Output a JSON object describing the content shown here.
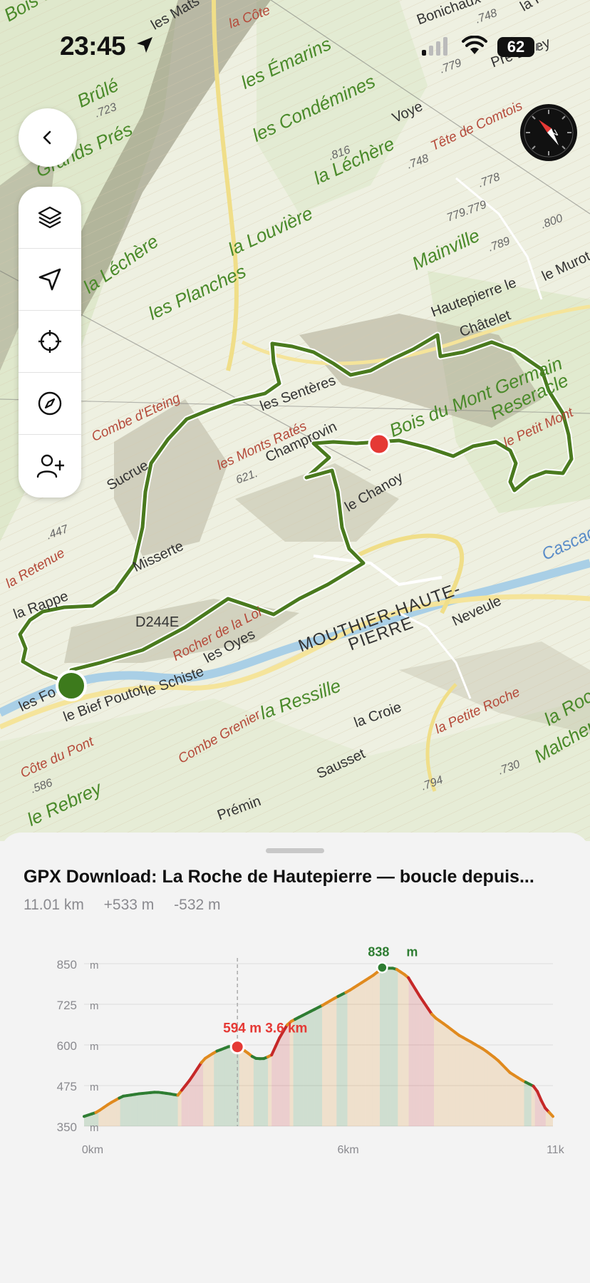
{
  "status_bar": {
    "time": "23:45",
    "battery": "62"
  },
  "map": {
    "labels": [
      {
        "text": "Bois de Houte",
        "style": "lbl-green",
        "x": 8,
        "y": 22,
        "rot": -30
      },
      {
        "text": "les Mats",
        "style": "lbl-dark",
        "x": 214,
        "y": 40,
        "rot": -30
      },
      {
        "text": "la Côte",
        "style": "lbl-red",
        "x": 322,
        "y": 38,
        "rot": -20
      },
      {
        "text": "Bonichaux",
        "style": "lbl-dark",
        "x": 586,
        "y": 32,
        "rot": -20
      },
      {
        "text": "la Pras",
        "style": "lbl-dark",
        "x": 732,
        "y": 14,
        "rot": -30
      },
      {
        "text": "Pré Lerey",
        "style": "lbl-dark",
        "x": 690,
        "y": 92,
        "rot": -20
      },
      {
        "text": "les Émarins",
        "style": "lbl-green",
        "x": 340,
        "y": 116,
        "rot": -25
      },
      {
        "text": "Brûlé",
        "style": "lbl-green",
        "x": 110,
        "y": 142,
        "rot": -25
      },
      {
        "text": "les Condémines",
        "style": "lbl-green",
        "x": 356,
        "y": 190,
        "rot": -25
      },
      {
        "text": "Voye",
        "style": "lbl-dark",
        "x": 552,
        "y": 170,
        "rot": -25
      },
      {
        "text": "Tête de Comtois",
        "style": "lbl-red",
        "x": 606,
        "y": 210,
        "rot": -25
      },
      {
        "text": "Grands Prés",
        "style": "lbl-green",
        "x": 52,
        "y": 240,
        "rot": -25
      },
      {
        "text": "la Léchère",
        "style": "lbl-green",
        "x": 442,
        "y": 250,
        "rot": -25
      },
      {
        "text": "la Léchère",
        "style": "lbl-green",
        "x": 120,
        "y": 404,
        "rot": -35
      },
      {
        "text": "les Planches",
        "style": "lbl-green",
        "x": 210,
        "y": 440,
        "rot": -25
      },
      {
        "text": "la Louvière",
        "style": "lbl-green",
        "x": 322,
        "y": 350,
        "rot": -25
      },
      {
        "text": "Mainville",
        "style": "lbl-green",
        "x": 580,
        "y": 370,
        "rot": -25
      },
      {
        "text": "le Murot",
        "style": "lbl-dark",
        "x": 762,
        "y": 392,
        "rot": -25
      },
      {
        "text": "Hautepierre le",
        "style": "lbl-dark",
        "x": 606,
        "y": 442,
        "rot": -20
      },
      {
        "text": "Châtelet",
        "style": "lbl-dark",
        "x": 646,
        "y": 470,
        "rot": -20
      },
      {
        "text": "les Sentères",
        "style": "lbl-dark",
        "x": 366,
        "y": 574,
        "rot": -20
      },
      {
        "text": "Bois du Mont Germain",
        "style": "lbl-green",
        "x": 548,
        "y": 604,
        "rot": -22
      },
      {
        "text": "Reseracle",
        "style": "lbl-green",
        "x": 690,
        "y": 580,
        "rot": -25
      },
      {
        "text": "le Petit Mont",
        "style": "lbl-red",
        "x": 708,
        "y": 626,
        "rot": -25
      },
      {
        "text": "Combe d'Eteing",
        "style": "lbl-red",
        "x": 130,
        "y": 618,
        "rot": -25
      },
      {
        "text": "les Monts Ratés",
        "style": "lbl-red",
        "x": 306,
        "y": 658,
        "rot": -25
      },
      {
        "text": "Champrovin",
        "style": "lbl-dark",
        "x": 374,
        "y": 646,
        "rot": -25
      },
      {
        "text": "Sucrue",
        "style": "lbl-dark",
        "x": 152,
        "y": 686,
        "rot": -30
      },
      {
        "text": "le Chanoy",
        "style": "lbl-dark",
        "x": 486,
        "y": 716,
        "rot": -30
      },
      {
        "text": "Cascade",
        "style": "lbl-blue",
        "x": 762,
        "y": 780,
        "rot": -25
      },
      {
        "text": "la Retenue",
        "style": "lbl-red",
        "x": 10,
        "y": 824,
        "rot": -30
      },
      {
        "text": "la Rappe",
        "style": "lbl-dark",
        "x": 20,
        "y": 866,
        "rot": -20
      },
      {
        "text": "Misserte",
        "style": "lbl-dark",
        "x": 188,
        "y": 800,
        "rot": -25
      },
      {
        "text": "D244E",
        "style": "lbl-dark",
        "x": 190,
        "y": 876,
        "rot": 0
      },
      {
        "text": "MOUTHIER-HAUTE-",
        "style": "lbl-big",
        "x": 420,
        "y": 908,
        "rot": -20
      },
      {
        "text": "PIERRE",
        "style": "lbl-big",
        "x": 490,
        "y": 906,
        "rot": -20
      },
      {
        "text": "Neveule",
        "style": "lbl-dark",
        "x": 636,
        "y": 876,
        "rot": -25
      },
      {
        "text": "Rocher de la Loi",
        "style": "lbl-red",
        "x": 244,
        "y": 926,
        "rot": -28
      },
      {
        "text": "les Oyes",
        "style": "lbl-dark",
        "x": 288,
        "y": 928,
        "rot": -28
      },
      {
        "text": "le Schiste",
        "style": "lbl-dark",
        "x": 204,
        "y": 974,
        "rot": -20
      },
      {
        "text": "les Fo",
        "style": "lbl-dark",
        "x": 28,
        "y": 996,
        "rot": -25
      },
      {
        "text": "le Bief Poutot",
        "style": "lbl-dark",
        "x": 90,
        "y": 1010,
        "rot": -20
      },
      {
        "text": "la Ressille",
        "style": "lbl-green",
        "x": 366,
        "y": 1000,
        "rot": -20
      },
      {
        "text": "la Croie",
        "style": "lbl-dark",
        "x": 498,
        "y": 1018,
        "rot": -20
      },
      {
        "text": "la Petite Roche",
        "style": "lbl-red",
        "x": 612,
        "y": 1028,
        "rot": -25
      },
      {
        "text": "la Roche",
        "style": "lbl-green",
        "x": 766,
        "y": 1010,
        "rot": -30
      },
      {
        "text": "Combe Grenier",
        "style": "lbl-red",
        "x": 252,
        "y": 1070,
        "rot": -30
      },
      {
        "text": "Côte du Pont",
        "style": "lbl-red",
        "x": 30,
        "y": 1090,
        "rot": -25
      },
      {
        "text": "Sausset",
        "style": "lbl-dark",
        "x": 446,
        "y": 1090,
        "rot": -25
      },
      {
        "text": "Malchen",
        "style": "lbl-green",
        "x": 752,
        "y": 1062,
        "rot": -30
      },
      {
        "text": "le Rebrey",
        "style": "lbl-green",
        "x": 40,
        "y": 1150,
        "rot": -25
      },
      {
        "text": "Prémin",
        "style": "lbl-dark",
        "x": 306,
        "y": 1148,
        "rot": -20
      }
    ],
    "spot_heights": [
      {
        "text": ".723",
        "x": 134,
        "y": 162
      },
      {
        "text": ".816",
        "x": 462,
        "y": 222
      },
      {
        "text": ".748",
        "x": 572,
        "y": 234
      },
      {
        "text": ".778",
        "x": 672,
        "y": 260
      },
      {
        "text": "779.779",
        "x": 628,
        "y": 308
      },
      {
        "text": ".800",
        "x": 760,
        "y": 318
      },
      {
        "text": ".789",
        "x": 686,
        "y": 350
      },
      {
        "text": ".748",
        "x": 668,
        "y": 30
      },
      {
        "text": ".779",
        "x": 618,
        "y": 100
      },
      {
        "text": ".447",
        "x": 66,
        "y": 754
      },
      {
        "text": "621.",
        "x": 332,
        "y": 676
      },
      {
        "text": ".586",
        "x": 44,
        "y": 1110
      },
      {
        "text": ".794",
        "x": 592,
        "y": 1106
      },
      {
        "text": ".730",
        "x": 700,
        "y": 1084
      }
    ]
  },
  "sheet": {
    "title": "GPX Download: La Roche de Hautepierre — boucle depuis...",
    "distance": "11.01 km",
    "ascent": "+533 m",
    "descent": "-532 m"
  },
  "chart_data": {
    "type": "area",
    "x_unit": "km",
    "y_unit": "m",
    "xlim": [
      0,
      11.01
    ],
    "ylim": [
      350,
      850
    ],
    "y_ticks": [
      "850",
      "725",
      "600",
      "475",
      "350"
    ],
    "y_tick_unit": "m",
    "x_ticks": [
      "0km",
      "6km",
      "11k"
    ],
    "x": [
      0,
      0.3,
      0.6,
      0.9,
      1.3,
      1.7,
      2.0,
      2.2,
      2.5,
      2.8,
      3.1,
      3.4,
      3.6,
      3.8,
      4.0,
      4.2,
      4.4,
      4.6,
      4.8,
      5.0,
      5.3,
      5.6,
      5.9,
      6.2,
      6.5,
      6.8,
      7.0,
      7.3,
      7.6,
      7.9,
      8.2,
      8.5,
      8.8,
      9.1,
      9.4,
      9.7,
      10.0,
      10.3,
      10.6,
      10.8,
      11.01
    ],
    "y": [
      380,
      393,
      420,
      442,
      450,
      455,
      450,
      445,
      495,
      555,
      580,
      595,
      595,
      580,
      559,
      557,
      568,
      625,
      668,
      682,
      702,
      722,
      745,
      765,
      790,
      815,
      836,
      836,
      810,
      746,
      688,
      660,
      630,
      608,
      585,
      555,
      515,
      490,
      470,
      410,
      380
    ],
    "marker": {
      "x": 3.6,
      "y": 594,
      "label": "594 m 3.6 km"
    },
    "max": {
      "x": 7.0,
      "y": 838,
      "label": "838",
      "unit": "m"
    },
    "colors": {
      "flat": "#2e7d32",
      "moderate": "#e08a1e",
      "steep": "#c62828",
      "marker": "#e53935"
    }
  }
}
